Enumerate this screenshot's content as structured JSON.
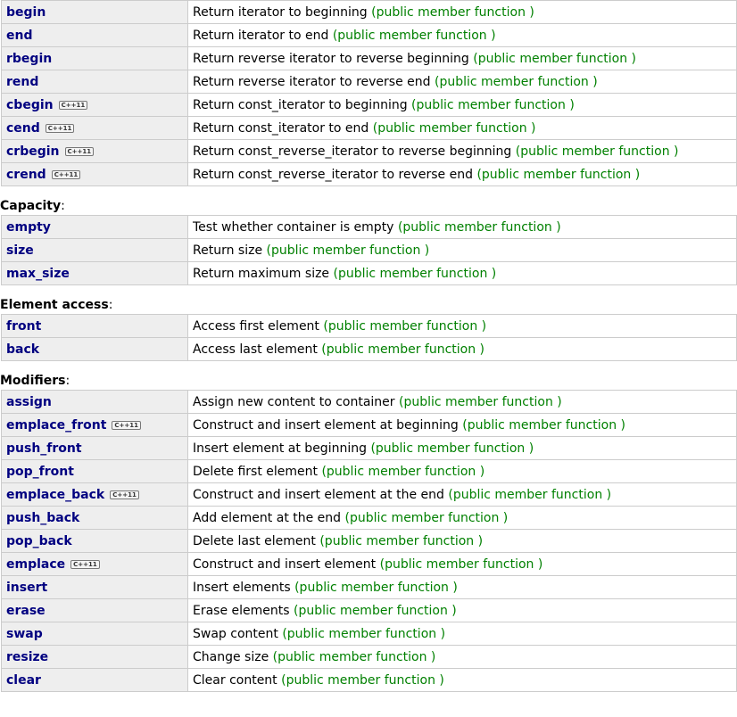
{
  "badge_label": "C++11",
  "kind_label": "(public member function )",
  "sections": [
    {
      "title": "",
      "rows": [
        {
          "name": "begin",
          "desc": "Return iterator to beginning",
          "cpp11": false
        },
        {
          "name": "end",
          "desc": "Return iterator to end",
          "cpp11": false
        },
        {
          "name": "rbegin",
          "desc": "Return reverse iterator to reverse beginning",
          "cpp11": false
        },
        {
          "name": "rend",
          "desc": "Return reverse iterator to reverse end",
          "cpp11": false
        },
        {
          "name": "cbegin",
          "desc": "Return const_iterator to beginning",
          "cpp11": true
        },
        {
          "name": "cend",
          "desc": "Return const_iterator to end",
          "cpp11": true
        },
        {
          "name": "crbegin",
          "desc": "Return const_reverse_iterator to reverse beginning",
          "cpp11": true
        },
        {
          "name": "crend",
          "desc": "Return const_reverse_iterator to reverse end",
          "cpp11": true
        }
      ]
    },
    {
      "title": "Capacity",
      "rows": [
        {
          "name": "empty",
          "desc": "Test whether container is empty",
          "cpp11": false
        },
        {
          "name": "size",
          "desc": "Return size",
          "cpp11": false
        },
        {
          "name": "max_size",
          "desc": "Return maximum size",
          "cpp11": false
        }
      ]
    },
    {
      "title": "Element access",
      "rows": [
        {
          "name": "front",
          "desc": "Access first element",
          "cpp11": false
        },
        {
          "name": "back",
          "desc": "Access last element",
          "cpp11": false
        }
      ]
    },
    {
      "title": "Modifiers",
      "rows": [
        {
          "name": "assign",
          "desc": "Assign new content to container",
          "cpp11": false
        },
        {
          "name": "emplace_front",
          "desc": "Construct and insert element at beginning",
          "cpp11": true
        },
        {
          "name": "push_front",
          "desc": "Insert element at beginning",
          "cpp11": false
        },
        {
          "name": "pop_front",
          "desc": "Delete first element",
          "cpp11": false
        },
        {
          "name": "emplace_back",
          "desc": "Construct and insert element at the end",
          "cpp11": true
        },
        {
          "name": "push_back",
          "desc": "Add element at the end",
          "cpp11": false
        },
        {
          "name": "pop_back",
          "desc": "Delete last element",
          "cpp11": false
        },
        {
          "name": "emplace",
          "desc": "Construct and insert element",
          "cpp11": true
        },
        {
          "name": "insert",
          "desc": "Insert elements",
          "cpp11": false
        },
        {
          "name": "erase",
          "desc": "Erase elements",
          "cpp11": false
        },
        {
          "name": "swap",
          "desc": "Swap content",
          "cpp11": false
        },
        {
          "name": "resize",
          "desc": "Change size",
          "cpp11": false
        },
        {
          "name": "clear",
          "desc": "Clear content",
          "cpp11": false
        }
      ]
    }
  ],
  "colors": {
    "name_text": "#000080",
    "name_bg": "#eeeeee",
    "kind_text": "#008000",
    "border": "#cccccc"
  }
}
